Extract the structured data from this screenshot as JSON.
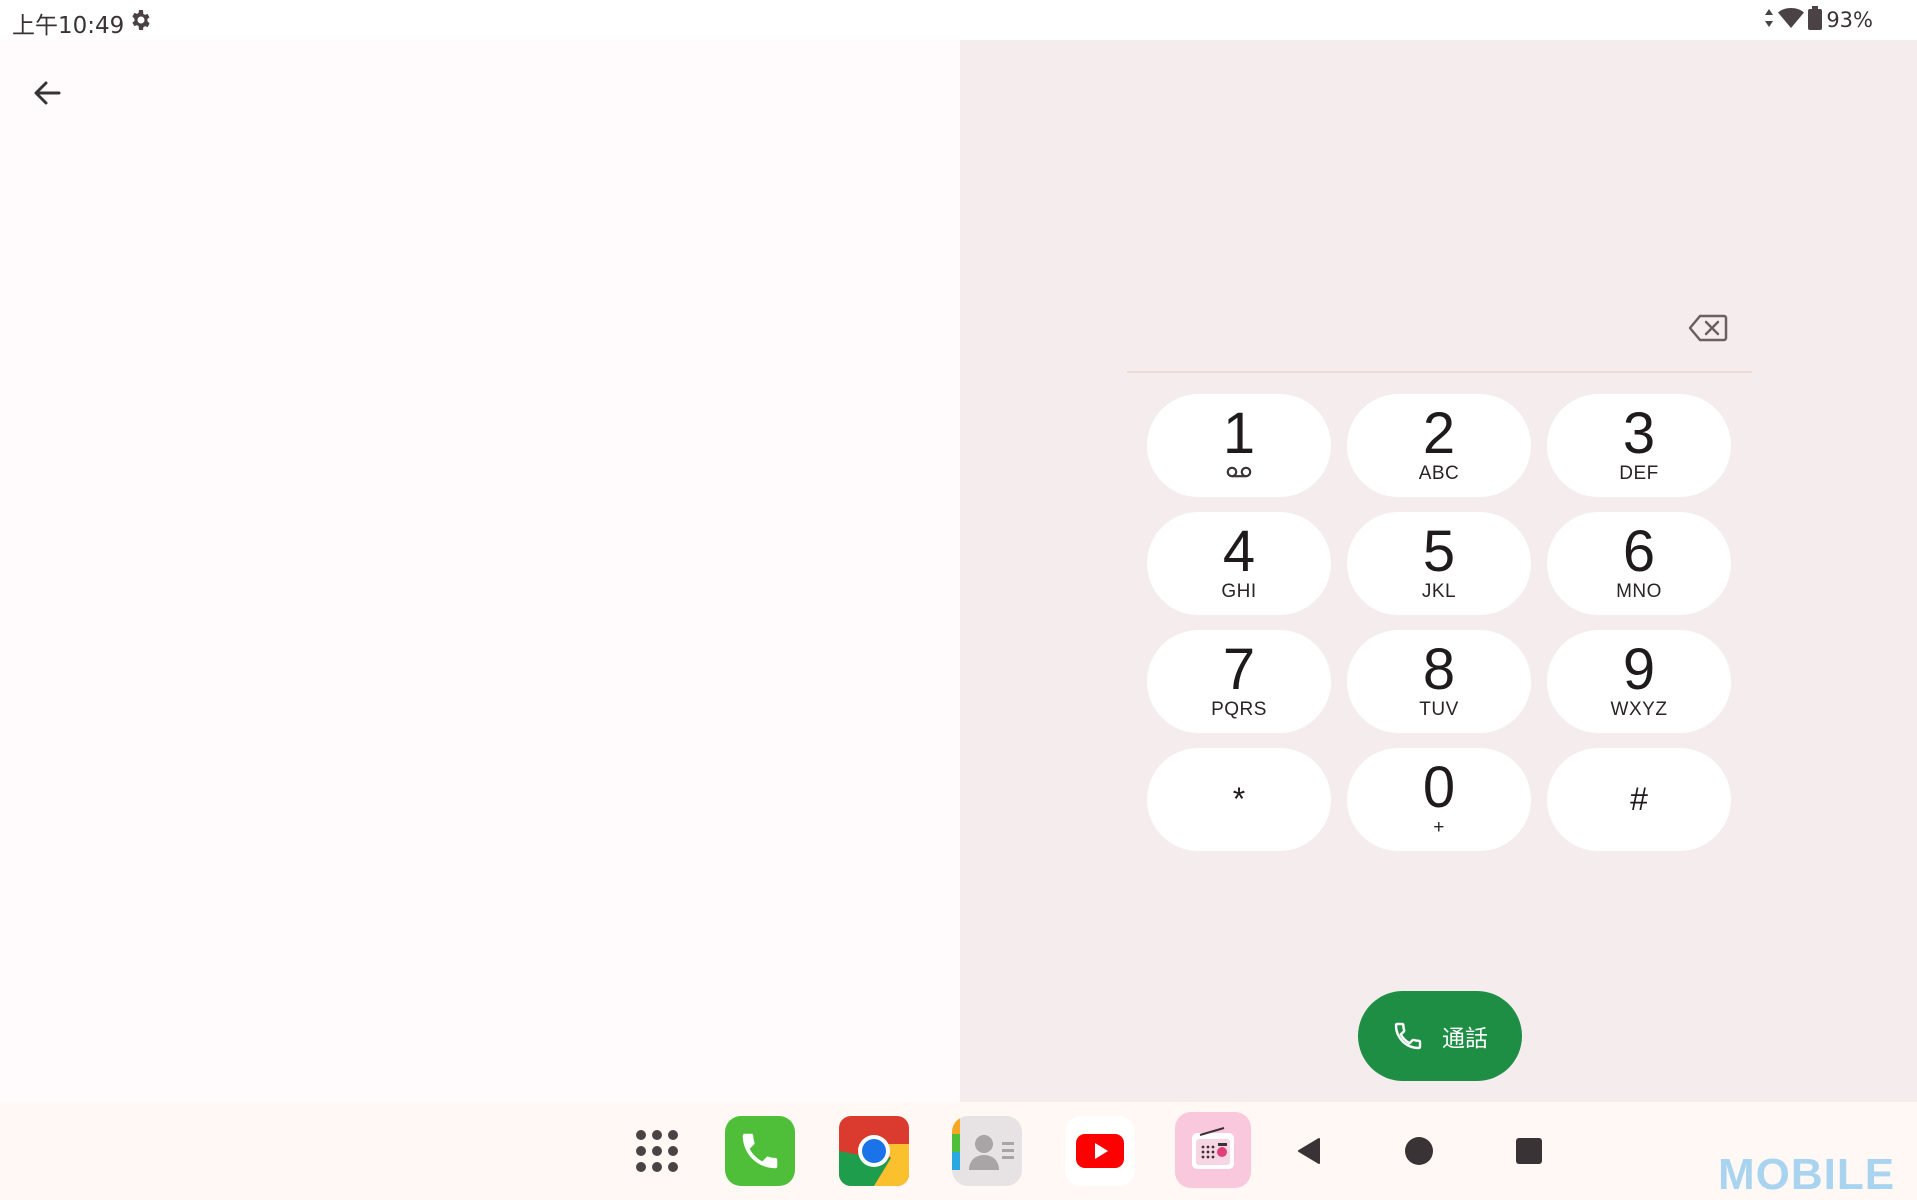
{
  "status_bar": {
    "time": "上午10:49",
    "battery": "93%"
  },
  "dialer": {
    "keys": [
      {
        "digit": "1",
        "letters": "",
        "sub_icon": "voicemail-icon"
      },
      {
        "digit": "2",
        "letters": "ABC"
      },
      {
        "digit": "3",
        "letters": "DEF"
      },
      {
        "digit": "4",
        "letters": "GHI"
      },
      {
        "digit": "5",
        "letters": "JKL"
      },
      {
        "digit": "6",
        "letters": "MNO"
      },
      {
        "digit": "7",
        "letters": "PQRS"
      },
      {
        "digit": "8",
        "letters": "TUV"
      },
      {
        "digit": "9",
        "letters": "WXYZ"
      },
      {
        "digit": "*",
        "letters": ""
      },
      {
        "digit": "0",
        "letters": "+"
      },
      {
        "digit": "#",
        "letters": ""
      }
    ],
    "call_label": "通話"
  },
  "dock": {
    "apps": [
      "apps-grid-icon",
      "phone-app-icon",
      "chrome-app-icon",
      "contacts-app-icon",
      "youtube-app-icon",
      "radio-app-icon"
    ],
    "nav": [
      "back-nav-icon",
      "home-nav-icon",
      "recents-nav-icon"
    ]
  },
  "watermark": "MOBILE",
  "colors": {
    "call_button": "#1d8e44",
    "right_pane": "#f4eced",
    "left_pane": "#fffbfd"
  }
}
